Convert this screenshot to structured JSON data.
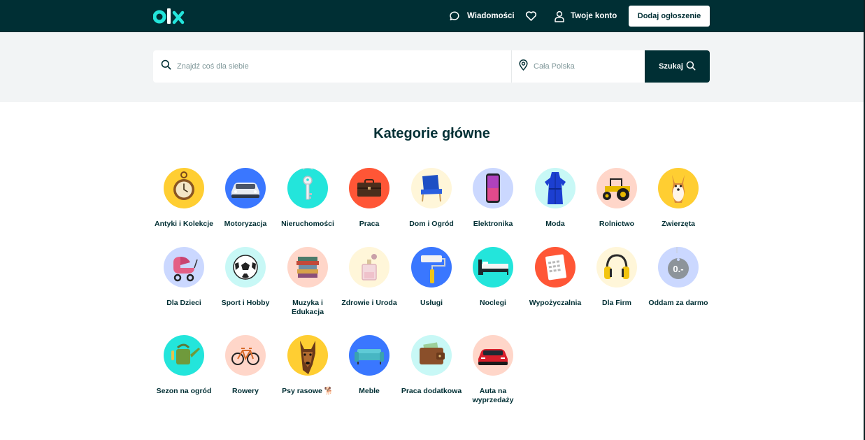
{
  "header": {
    "logo_text": "olx",
    "messages_label": "Wiadomości",
    "account_label": "Twoje konto",
    "add_listing_label": "Dodaj ogłoszenie"
  },
  "search": {
    "query_placeholder": "Znajdź coś dla siebie",
    "location_value": "Cała Polska",
    "button_label": "Szukaj"
  },
  "main": {
    "title": "Kategorie główne",
    "categories": [
      {
        "label": "Antyki i Kolekcje",
        "icon": "pocket-watch-icon",
        "bg": "#ffce32"
      },
      {
        "label": "Motoryzacja",
        "icon": "car-icon",
        "bg": "#3a77ff"
      },
      {
        "label": "Nieruchomości",
        "icon": "key-icon",
        "bg": "#23e5db"
      },
      {
        "label": "Praca",
        "icon": "briefcase-icon",
        "bg": "#ff5636"
      },
      {
        "label": "Dom i Ogród",
        "icon": "armchair-icon",
        "bg": "#fff6d9"
      },
      {
        "label": "Elektronika",
        "icon": "smartphone-icon",
        "bg": "#cbd8ff"
      },
      {
        "label": "Moda",
        "icon": "dress-icon",
        "bg": "#c8f8f6"
      },
      {
        "label": "Rolnictwo",
        "icon": "tractor-icon",
        "bg": "#ffd6c9"
      },
      {
        "label": "Zwierzęta",
        "icon": "dog-icon",
        "bg": "#ffce32"
      },
      {
        "label": "Dla Dzieci",
        "icon": "stroller-icon",
        "bg": "#cbd8ff"
      },
      {
        "label": "Sport i Hobby",
        "icon": "football-icon",
        "bg": "#c8f8f6"
      },
      {
        "label": "Muzyka i Edukacja",
        "icon": "books-icon",
        "bg": "#ffd6c9"
      },
      {
        "label": "Zdrowie i Uroda",
        "icon": "perfume-icon",
        "bg": "#fff6d9"
      },
      {
        "label": "Usługi",
        "icon": "paint-roller-icon",
        "bg": "#3a77ff"
      },
      {
        "label": "Noclegi",
        "icon": "bed-icon",
        "bg": "#23e5db"
      },
      {
        "label": "Wypożyczalnia",
        "icon": "calendar-icon",
        "bg": "#ff5636"
      },
      {
        "label": "Dla Firm",
        "icon": "headphones-icon",
        "bg": "#fff6d9"
      },
      {
        "label": "Oddam za darmo",
        "icon": "price-tag-icon",
        "bg": "#cbd8ff",
        "tag_text": "0.-"
      },
      {
        "label": "Sezon na ogród",
        "icon": "watering-can-icon",
        "bg": "#23e5db"
      },
      {
        "label": "Rowery",
        "icon": "bicycle-icon",
        "bg": "#ffd6c9"
      },
      {
        "label": "Psy rasowe 🐕",
        "icon": "german-shepherd-icon",
        "bg": "#ffce32"
      },
      {
        "label": "Meble",
        "icon": "sofa-icon",
        "bg": "#3a77ff"
      },
      {
        "label": "Praca dodatkowa",
        "icon": "wallet-icon",
        "bg": "#c8f8f6"
      },
      {
        "label": "Auta na wyprzedaży",
        "icon": "red-car-icon",
        "bg": "#ffd6c9"
      }
    ]
  },
  "colors": {
    "brand_dark": "#002f34",
    "brand_teal": "#23e5db",
    "search_band": "#f2f4f5"
  }
}
